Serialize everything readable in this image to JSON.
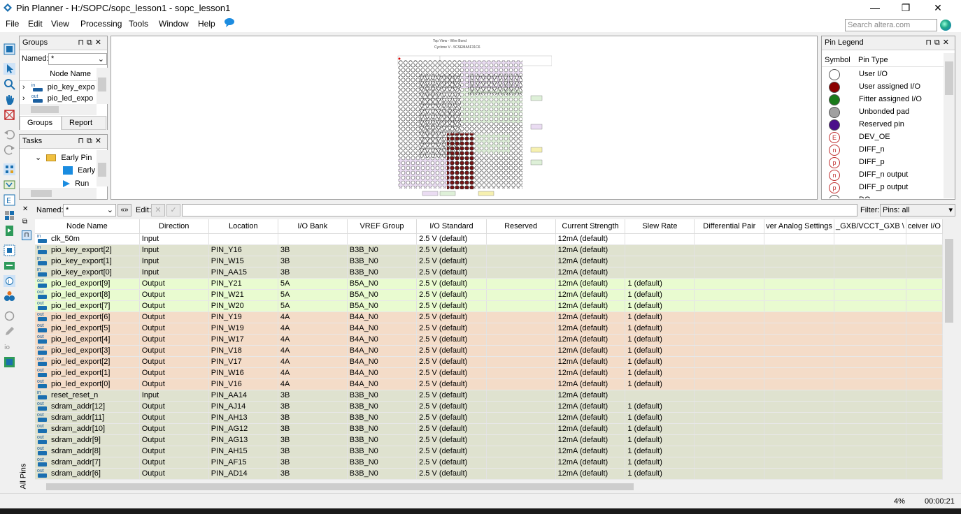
{
  "window": {
    "title": "Pin Planner - H:/SOPC/sopc_lesson1 - sopc_lesson1",
    "minimize": "—",
    "maximize": "❐",
    "close": "✕"
  },
  "menu": {
    "items": [
      "File",
      "Edit",
      "View",
      "Processing",
      "Tools",
      "Window",
      "Help"
    ],
    "search_placeholder": "Search altera.com"
  },
  "groups_panel": {
    "title": "Groups",
    "named_label": "Named:",
    "named_value": "*",
    "column": "Node Name",
    "rows": [
      "pio_key_expo",
      "pio_led_expo"
    ],
    "tabs": [
      "Groups",
      "Report"
    ]
  },
  "tasks_panel": {
    "title": "Tasks",
    "rows": [
      "Early Pin",
      "Early",
      "Run"
    ]
  },
  "chip_view": {
    "title": "Top View - Wire Bond",
    "subtitle": "Cyclone V - 5CSEMA5F31C6"
  },
  "legend_panel": {
    "title": "Pin Legend",
    "col_symbol": "Symbol",
    "col_type": "Pin Type",
    "items": [
      {
        "label": "User I/O",
        "color": "#ffffff",
        "glyph": ""
      },
      {
        "label": "User assigned I/O",
        "color": "#8b0000",
        "glyph": ""
      },
      {
        "label": "Fitter assigned I/O",
        "color": "#1a7a1a",
        "glyph": ""
      },
      {
        "label": "Unbonded pad",
        "color": "#a0a0a0",
        "glyph": ""
      },
      {
        "label": "Reserved pin",
        "color": "#4b0f8a",
        "glyph": ""
      },
      {
        "label": "DEV_OE",
        "color": "#ffffff",
        "glyph": "E"
      },
      {
        "label": "DIFF_n",
        "color": "#ffffff",
        "glyph": "n"
      },
      {
        "label": "DIFF_p",
        "color": "#ffffff",
        "glyph": "p"
      },
      {
        "label": "DIFF_n output",
        "color": "#ffffff",
        "glyph": "n"
      },
      {
        "label": "DIFF_p output",
        "color": "#ffffff",
        "glyph": "p"
      },
      {
        "label": "DQ",
        "color": "#ffffff",
        "glyph": ""
      }
    ]
  },
  "pin_table": {
    "named_label": "Named:",
    "named_value": "*",
    "edit_label": "Edit:",
    "filter_label": "Filter:",
    "filter_value": "Pins: all",
    "side_tab": "All Pins",
    "columns": [
      "Node Name",
      "Direction",
      "Location",
      "I/O Bank",
      "VREF Group",
      "I/O Standard",
      "Reserved",
      "Current Strength",
      "Slew Rate",
      "Differential Pair",
      "ver Analog Settings",
      "_GXB/VCCT_GXB \\",
      "ceiver I/O"
    ],
    "rows": [
      {
        "icon": "in",
        "name": "clk_50m",
        "direction": "Input",
        "location": "",
        "bank": "",
        "vref": "",
        "standard": "2.5 V (default)",
        "reserved": "",
        "current": "12mA (default)",
        "slew": "",
        "group": "plain"
      },
      {
        "icon": "in",
        "name": "pio_key_export[2]",
        "direction": "Input",
        "location": "PIN_Y16",
        "bank": "3B",
        "vref": "B3B_N0",
        "standard": "2.5 V (default)",
        "reserved": "",
        "current": "12mA (default)",
        "slew": "",
        "group": "in"
      },
      {
        "icon": "in",
        "name": "pio_key_export[1]",
        "direction": "Input",
        "location": "PIN_W15",
        "bank": "3B",
        "vref": "B3B_N0",
        "standard": "2.5 V (default)",
        "reserved": "",
        "current": "12mA (default)",
        "slew": "",
        "group": "in"
      },
      {
        "icon": "in",
        "name": "pio_key_export[0]",
        "direction": "Input",
        "location": "PIN_AA15",
        "bank": "3B",
        "vref": "B3B_N0",
        "standard": "2.5 V (default)",
        "reserved": "",
        "current": "12mA (default)",
        "slew": "",
        "group": "in"
      },
      {
        "icon": "out",
        "name": "pio_led_export[9]",
        "direction": "Output",
        "location": "PIN_Y21",
        "bank": "5A",
        "vref": "B5A_N0",
        "standard": "2.5 V (default)",
        "reserved": "",
        "current": "12mA (default)",
        "slew": "1 (default)",
        "group": "5a"
      },
      {
        "icon": "out",
        "name": "pio_led_export[8]",
        "direction": "Output",
        "location": "PIN_W21",
        "bank": "5A",
        "vref": "B5A_N0",
        "standard": "2.5 V (default)",
        "reserved": "",
        "current": "12mA (default)",
        "slew": "1 (default)",
        "group": "5a"
      },
      {
        "icon": "out",
        "name": "pio_led_export[7]",
        "direction": "Output",
        "location": "PIN_W20",
        "bank": "5A",
        "vref": "B5A_N0",
        "standard": "2.5 V (default)",
        "reserved": "",
        "current": "12mA (default)",
        "slew": "1 (default)",
        "group": "5a"
      },
      {
        "icon": "out",
        "name": "pio_led_export[6]",
        "direction": "Output",
        "location": "PIN_Y19",
        "bank": "4A",
        "vref": "B4A_N0",
        "standard": "2.5 V (default)",
        "reserved": "",
        "current": "12mA (default)",
        "slew": "1 (default)",
        "group": "4a"
      },
      {
        "icon": "out",
        "name": "pio_led_export[5]",
        "direction": "Output",
        "location": "PIN_W19",
        "bank": "4A",
        "vref": "B4A_N0",
        "standard": "2.5 V (default)",
        "reserved": "",
        "current": "12mA (default)",
        "slew": "1 (default)",
        "group": "4a"
      },
      {
        "icon": "out",
        "name": "pio_led_export[4]",
        "direction": "Output",
        "location": "PIN_W17",
        "bank": "4A",
        "vref": "B4A_N0",
        "standard": "2.5 V (default)",
        "reserved": "",
        "current": "12mA (default)",
        "slew": "1 (default)",
        "group": "4a"
      },
      {
        "icon": "out",
        "name": "pio_led_export[3]",
        "direction": "Output",
        "location": "PIN_V18",
        "bank": "4A",
        "vref": "B4A_N0",
        "standard": "2.5 V (default)",
        "reserved": "",
        "current": "12mA (default)",
        "slew": "1 (default)",
        "group": "4a"
      },
      {
        "icon": "out",
        "name": "pio_led_export[2]",
        "direction": "Output",
        "location": "PIN_V17",
        "bank": "4A",
        "vref": "B4A_N0",
        "standard": "2.5 V (default)",
        "reserved": "",
        "current": "12mA (default)",
        "slew": "1 (default)",
        "group": "4a"
      },
      {
        "icon": "out",
        "name": "pio_led_export[1]",
        "direction": "Output",
        "location": "PIN_W16",
        "bank": "4A",
        "vref": "B4A_N0",
        "standard": "2.5 V (default)",
        "reserved": "",
        "current": "12mA (default)",
        "slew": "1 (default)",
        "group": "4a"
      },
      {
        "icon": "out",
        "name": "pio_led_export[0]",
        "direction": "Output",
        "location": "PIN_V16",
        "bank": "4A",
        "vref": "B4A_N0",
        "standard": "2.5 V (default)",
        "reserved": "",
        "current": "12mA (default)",
        "slew": "1 (default)",
        "group": "4a"
      },
      {
        "icon": "in",
        "name": "reset_reset_n",
        "direction": "Input",
        "location": "PIN_AA14",
        "bank": "3B",
        "vref": "B3B_N0",
        "standard": "2.5 V (default)",
        "reserved": "",
        "current": "12mA (default)",
        "slew": "",
        "group": "in"
      },
      {
        "icon": "out",
        "name": "sdram_addr[12]",
        "direction": "Output",
        "location": "PIN_AJ14",
        "bank": "3B",
        "vref": "B3B_N0",
        "standard": "2.5 V (default)",
        "reserved": "",
        "current": "12mA (default)",
        "slew": "1 (default)",
        "group": "in"
      },
      {
        "icon": "out",
        "name": "sdram_addr[11]",
        "direction": "Output",
        "location": "PIN_AH13",
        "bank": "3B",
        "vref": "B3B_N0",
        "standard": "2.5 V (default)",
        "reserved": "",
        "current": "12mA (default)",
        "slew": "1 (default)",
        "group": "in"
      },
      {
        "icon": "out",
        "name": "sdram_addr[10]",
        "direction": "Output",
        "location": "PIN_AG12",
        "bank": "3B",
        "vref": "B3B_N0",
        "standard": "2.5 V (default)",
        "reserved": "",
        "current": "12mA (default)",
        "slew": "1 (default)",
        "group": "in"
      },
      {
        "icon": "out",
        "name": "sdram_addr[9]",
        "direction": "Output",
        "location": "PIN_AG13",
        "bank": "3B",
        "vref": "B3B_N0",
        "standard": "2.5 V (default)",
        "reserved": "",
        "current": "12mA (default)",
        "slew": "1 (default)",
        "group": "in"
      },
      {
        "icon": "out",
        "name": "sdram_addr[8]",
        "direction": "Output",
        "location": "PIN_AH15",
        "bank": "3B",
        "vref": "B3B_N0",
        "standard": "2.5 V (default)",
        "reserved": "",
        "current": "12mA (default)",
        "slew": "1 (default)",
        "group": "in"
      },
      {
        "icon": "out",
        "name": "sdram_addr[7]",
        "direction": "Output",
        "location": "PIN_AF15",
        "bank": "3B",
        "vref": "B3B_N0",
        "standard": "2.5 V (default)",
        "reserved": "",
        "current": "12mA (default)",
        "slew": "1 (default)",
        "group": "in"
      },
      {
        "icon": "out",
        "name": "sdram_addr[6]",
        "direction": "Output",
        "location": "PIN_AD14",
        "bank": "3B",
        "vref": "B3B_N0",
        "standard": "2.5 V (default)",
        "reserved": "",
        "current": "12mA (default)",
        "slew": "1 (default)",
        "group": "in"
      }
    ]
  },
  "status": {
    "progress": "4%",
    "elapsed": "00:00:21"
  }
}
